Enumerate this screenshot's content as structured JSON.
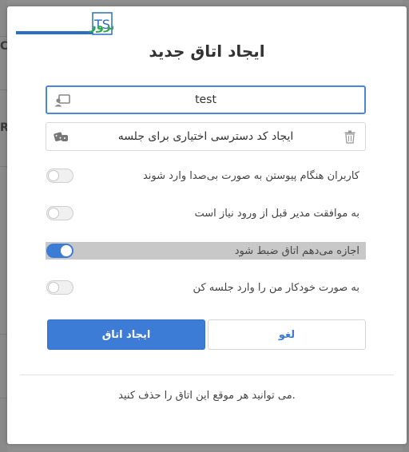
{
  "background": {
    "left_fragments": [
      "C",
      "R"
    ]
  },
  "logo": {
    "mark": "TS",
    "brand_text": "تهران سرور"
  },
  "dialog": {
    "title": "ایجاد اتاق جدید",
    "room_name_input": {
      "value": "test"
    },
    "access_code_field": {
      "label": "ایجاد کد دسترسی اختیاری برای جلسه"
    },
    "options": [
      {
        "label": "کاربران هنگام پیوستن به صورت بی‌صدا وارد شوند",
        "checked": false
      },
      {
        "label": "به موافقت مدیر قبل از ورود نیاز است",
        "checked": false
      },
      {
        "label": "اجازه می‌دهم اتاق ضبط شود",
        "checked": true
      },
      {
        "label": "به صورت خودکار من را وارد جلسه کن",
        "checked": false
      }
    ],
    "create_button": "ایجاد اتاق",
    "cancel_button": "لغو",
    "footnote": ".می توانید هر موقع این اتاق را حذف کنید"
  },
  "colors": {
    "accent": "#3d7cd6",
    "logo_blue": "#2a6fc2",
    "logo_green": "#2fa84f"
  }
}
